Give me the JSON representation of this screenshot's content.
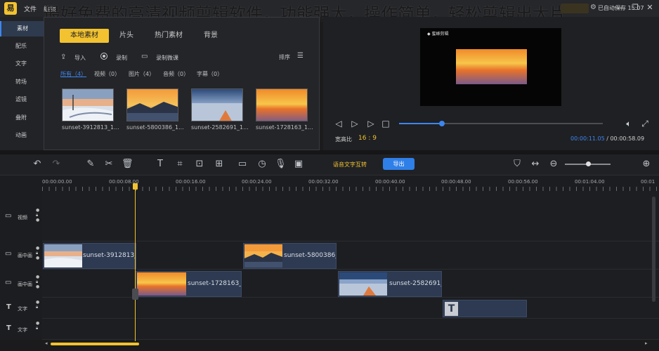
{
  "titlebar": {
    "logo_text": "易",
    "menus": [
      "文件",
      "编辑"
    ],
    "overlay_title": "最好免费的高清视频剪辑软件，功能强大，操作简单，轻松剪辑出大片",
    "autosave": "已自动保存 15:07",
    "window_buttons": [
      "minimize-icon",
      "restore-icon",
      "close-icon"
    ]
  },
  "sidebar": {
    "items": [
      {
        "label": "素材",
        "active": true
      },
      {
        "label": "配乐"
      },
      {
        "label": "文字"
      },
      {
        "label": "转场"
      },
      {
        "label": "滤镜"
      },
      {
        "label": "叠附"
      },
      {
        "label": "动画"
      }
    ]
  },
  "media": {
    "tabs": [
      "本地素材",
      "片头",
      "热门素材",
      "背景"
    ],
    "toolbar": {
      "import": "导入",
      "record": "录制",
      "record_lesson": "录制微课",
      "sort": "排序"
    },
    "filters": [
      "所有（4）",
      "视频（0）",
      "图片（4）",
      "音频（0）",
      "字幕（0）"
    ],
    "items": [
      {
        "name": "sunset-3912813_1..."
      },
      {
        "name": "sunset-5800386_1..."
      },
      {
        "name": "sunset-2582691_1..."
      },
      {
        "name": "sunset-1728163_1..."
      }
    ]
  },
  "preview": {
    "watermark": "◆ 蜜蜂剪辑",
    "ratio_label": "宽高比",
    "ratio_value": "16 : 9",
    "time_current": "00:00:11.05",
    "time_separator": " / ",
    "time_total": "00:00:58.09",
    "progress": 0.21
  },
  "toolbar": {
    "speech_to_text": "语音文字互转",
    "export_label": "导出"
  },
  "ruler": {
    "labels": [
      "00:00:00.00",
      "00:00:08.00",
      "00:00:16.00",
      "00:00:24.00",
      "00:00:32.00",
      "00:00:40.00",
      "00:00:48.00",
      "00:00:56.00",
      "00:01:04.00",
      "00:01"
    ]
  },
  "tracks": [
    {
      "label": "视频"
    },
    {
      "label": "画中画"
    },
    {
      "label": "画中画"
    },
    {
      "label": "文字"
    },
    {
      "label": "文字"
    }
  ],
  "clips": {
    "pip1_a": "sunset-3912813_",
    "pip1_b": "sunset-5800386_",
    "pip2_a": "sunset-1728163_",
    "pip2_b": "sunset-2582691_",
    "text_clip_glyph": "T"
  },
  "colors": {
    "accent_yellow": "#f2c230",
    "accent_blue": "#3d86ef",
    "background": "#1b1b1d"
  }
}
